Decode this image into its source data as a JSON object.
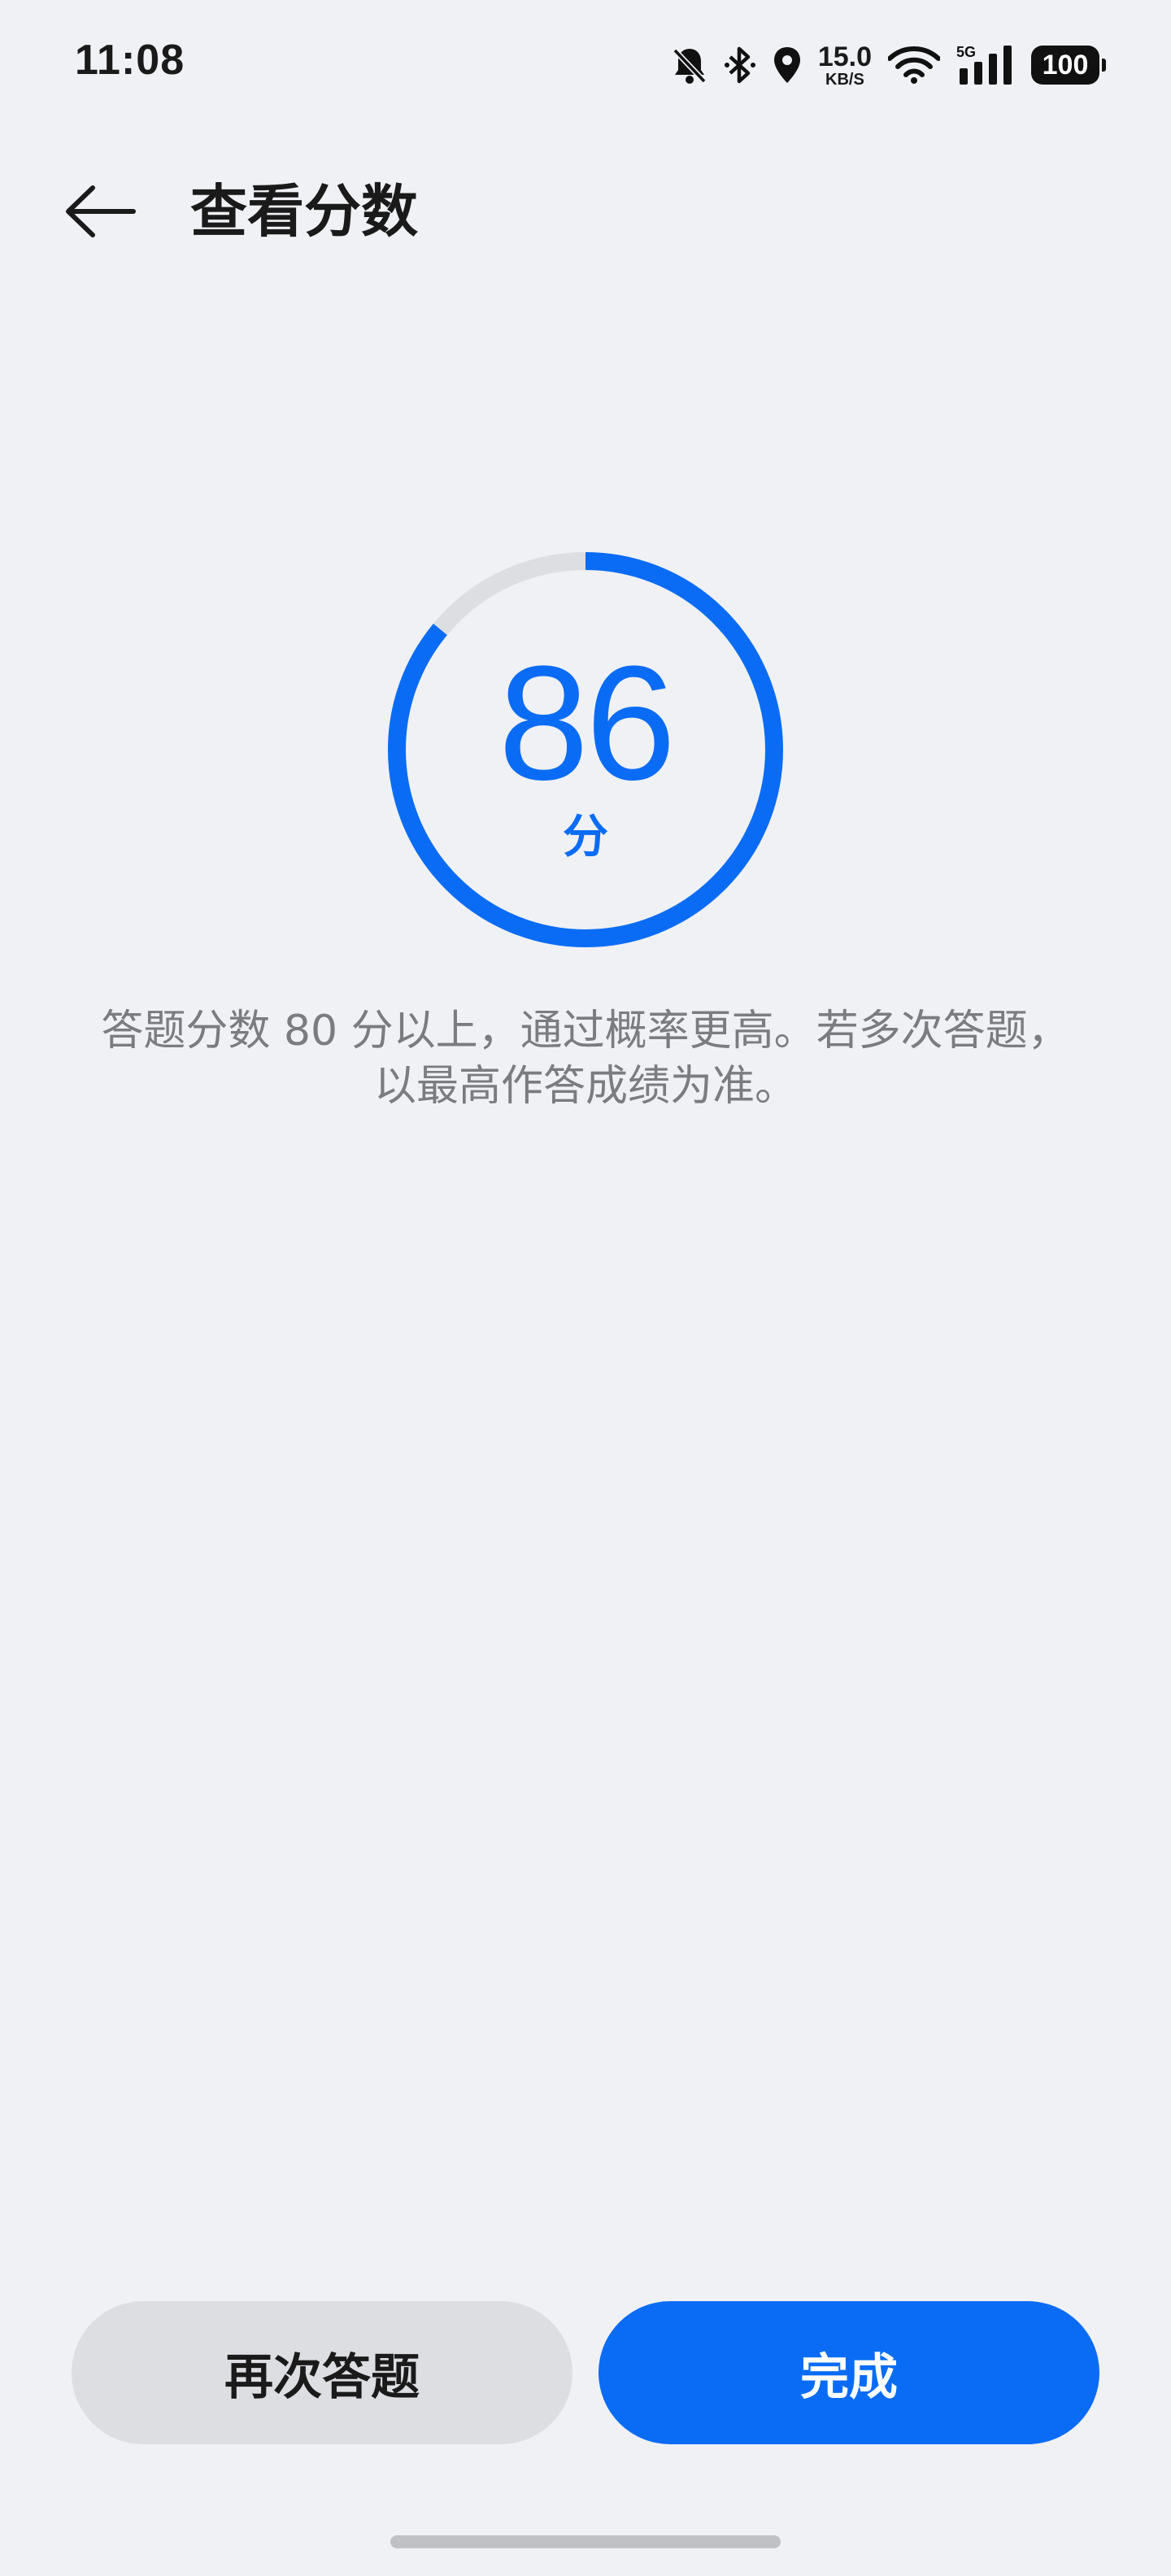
{
  "status_bar": {
    "time": "11:08",
    "net_speed_value": "15.0",
    "net_speed_unit": "KB/S",
    "network_type": "5G",
    "battery": "100",
    "icons": [
      "mute-bell-icon",
      "bluetooth-icon",
      "location-icon",
      "wifi-icon",
      "signal-icon",
      "battery-icon"
    ]
  },
  "header": {
    "back_icon": "back-arrow-icon",
    "title": "查看分数"
  },
  "score": {
    "value": "86",
    "unit": "分",
    "progress_fraction": 0.86,
    "ring_color": "#0a6cf5",
    "track_color": "#dcdee1"
  },
  "description": "答题分数 80 分以上，通过概率更高。若多次答题，以最高作答成绩为准。",
  "actions": {
    "retry_label": "再次答题",
    "done_label": "完成",
    "done_color": "#0a6cf5"
  }
}
